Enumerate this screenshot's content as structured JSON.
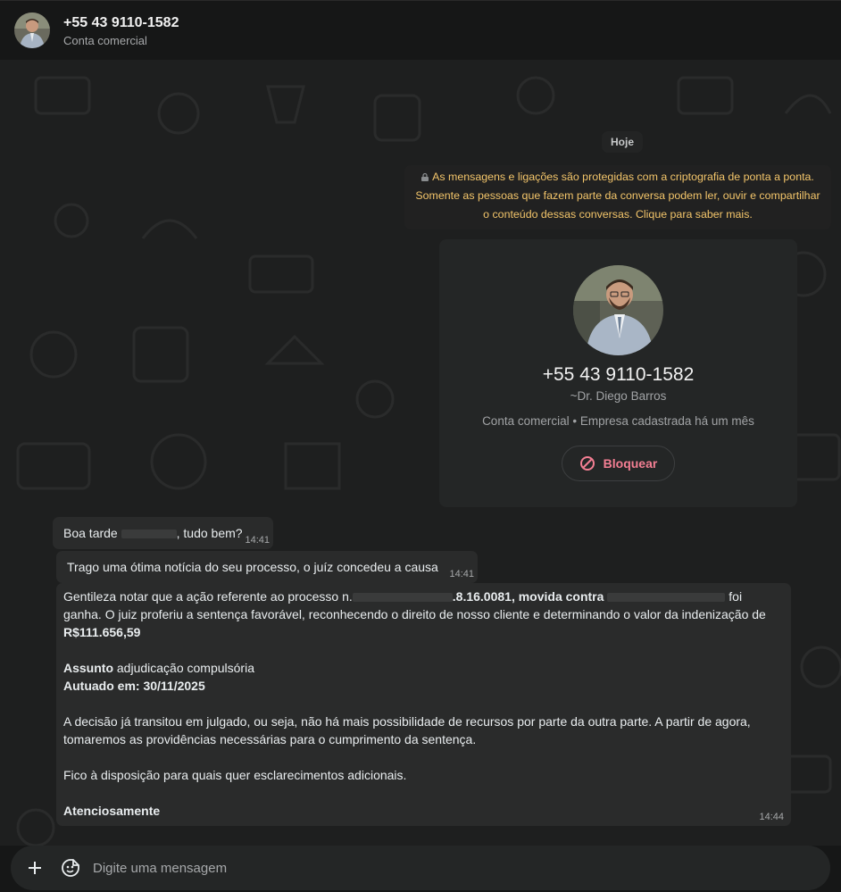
{
  "header": {
    "title": "+55 43 9110-1582",
    "subtitle": "Conta comercial"
  },
  "chat": {
    "date_chip": "Hoje",
    "encryption_notice": "As mensagens e ligações são protegidas com a criptografia de ponta a ponta. Somente as pessoas que fazem parte da conversa podem ler, ouvir e compartilhar o conteúdo dessas conversas. Clique para saber mais.",
    "contact_card": {
      "phone": "+55 43 9110-1582",
      "name": "~Dr. Diego Barros",
      "business_info": "Conta comercial • Empresa cadastrada há um mês",
      "block_label": "Bloquear"
    },
    "messages": [
      {
        "text_start": "Boa tarde",
        "text_end": ", tudo bem?",
        "time": "14:41"
      },
      {
        "text": "Trago uma ótima notícia do seu processo, o juíz concedeu a causa",
        "time": "14:41"
      },
      {
        "p1_start": "Gentileza notar que a ação referente ao processo n.",
        "p1_bold_mid": ".8.16.0081, movida contra",
        "p1_after": " foi ganha. O juiz proferiu a sentença favorável, reconhecendo o direito de nosso cliente e determinando o valor da indenização de",
        "amount": "R$111.656,59",
        "assunto_label": "Assunto",
        "assunto_value": " adjudicação compulsória",
        "autuado": "Autuado em: 30/11/2025",
        "p3": "A decisão já transitou em julgado, ou seja, não há mais possibilidade de recursos por parte da outra parte. A partir de agora, tomaremos as providências necessárias para o cumprimento da sentença.",
        "p4": "Fico à disposição para quais quer esclarecimentos adicionais.",
        "closing": "Atenciosamente",
        "time": "14:44"
      }
    ]
  },
  "composer": {
    "placeholder": "Digite uma mensagem"
  }
}
